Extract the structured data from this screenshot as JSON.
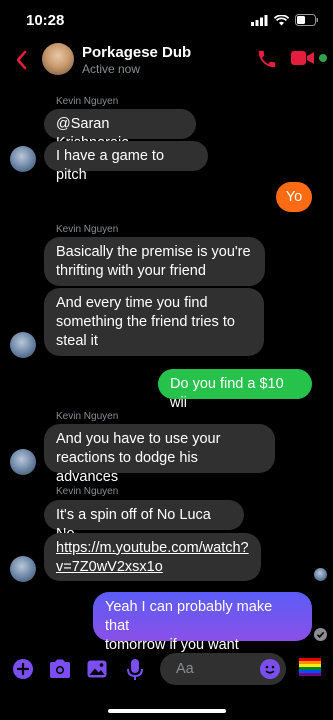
{
  "status": {
    "time": "10:28"
  },
  "header": {
    "title": "Porkagese Dub",
    "subtitle": "Active now"
  },
  "messages": {
    "sender_name": "Kevin Nguyen",
    "m1": "@Saran Krishnaraja",
    "m2": "I have a game to pitch",
    "m3": "Yo",
    "m4_l1": "Basically the premise is you're",
    "m4_l2": "thrifting with your friend",
    "m5_l1": "And every time you find",
    "m5_l2": "something the friend tries to",
    "m5_l3": "steal it",
    "m6": "Do you find a $10 wii",
    "m7_l1": "And you have to use your",
    "m7_l2": "reactions to dodge his advances",
    "m8": "It's a spin off of No Luca No",
    "m9_l1": "https://m.youtube.com/watch?",
    "m9_l2": "v=7Z0wV2xsx1o",
    "m10_l1": "Yeah I can probably make that",
    "m10_l2": "tomorrow if you want"
  },
  "composer": {
    "placeholder": "Aa"
  },
  "colors": {
    "accent": "#7b4ef0",
    "call_red": "#e41e3f",
    "orange": "#ff6b12",
    "green": "#27c24c"
  },
  "icons": [
    "back-chevron-icon",
    "phone-icon",
    "video-camera-icon",
    "plus-icon",
    "camera-icon",
    "image-icon",
    "microphone-icon",
    "emoji-icon",
    "pride-flag-icon"
  ]
}
